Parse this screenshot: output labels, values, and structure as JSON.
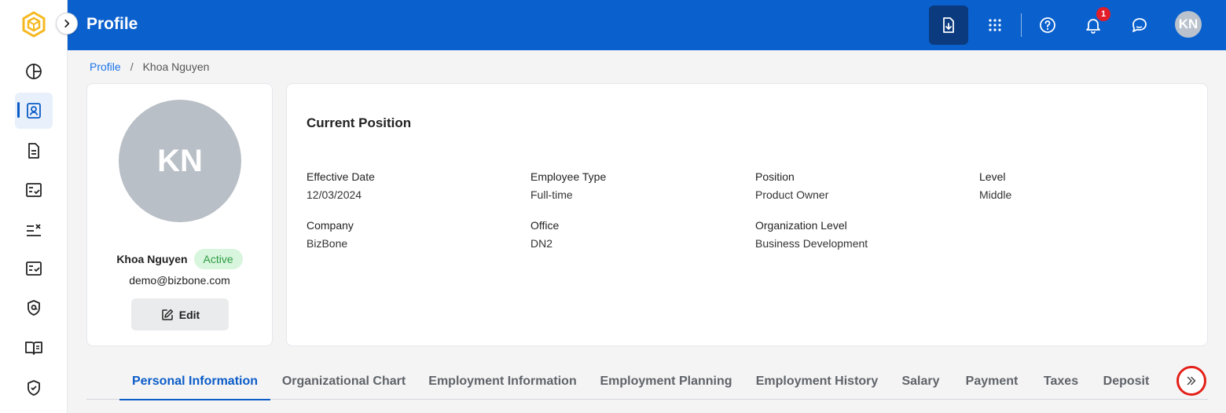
{
  "app": {
    "title": "Profile"
  },
  "header": {
    "notifications_count": "1",
    "user_initials": "KN"
  },
  "breadcrumb": {
    "link": "Profile",
    "separator": "/",
    "current": "Khoa Nguyen"
  },
  "profile": {
    "initials": "KN",
    "name": "Khoa Nguyen",
    "status": "Active",
    "email": "demo@bizbone.com",
    "edit_label": "Edit"
  },
  "position": {
    "title": "Current Position",
    "fields": [
      {
        "label": "Effective Date",
        "value": "12/03/2024"
      },
      {
        "label": "Employee Type",
        "value": "Full-time"
      },
      {
        "label": "Position",
        "value": "Product Owner"
      },
      {
        "label": "Level",
        "value": "Middle"
      },
      {
        "label": "Company",
        "value": "BizBone"
      },
      {
        "label": "Office",
        "value": "DN2"
      },
      {
        "label": "Organization Level",
        "value": "Business Development"
      }
    ]
  },
  "tabs": [
    {
      "label": "Personal Information",
      "active": true
    },
    {
      "label": "Organizational Chart"
    },
    {
      "label": "Employment Information"
    },
    {
      "label": "Employment Planning"
    },
    {
      "label": "Employment History"
    },
    {
      "label": "Salary"
    },
    {
      "label": "Payment"
    },
    {
      "label": "Taxes"
    },
    {
      "label": "Deposit"
    }
  ],
  "colors": {
    "header": "#0a60cd",
    "accent": "#0b5cc7",
    "status_bg": "#d8f5dd",
    "status_text": "#2e9c44",
    "badge": "#e11d2a",
    "highlight_ring": "#e32018"
  },
  "icons": {
    "sidebar": [
      "dashboard-icon",
      "profile-icon",
      "document-icon",
      "checklist-icon",
      "task-list-icon",
      "approval-icon",
      "policy-icon",
      "handbook-icon",
      "shield-check-icon"
    ],
    "header": [
      "download-document-icon",
      "apps-grid-icon",
      "help-icon",
      "bell-icon",
      "chat-icon"
    ]
  }
}
